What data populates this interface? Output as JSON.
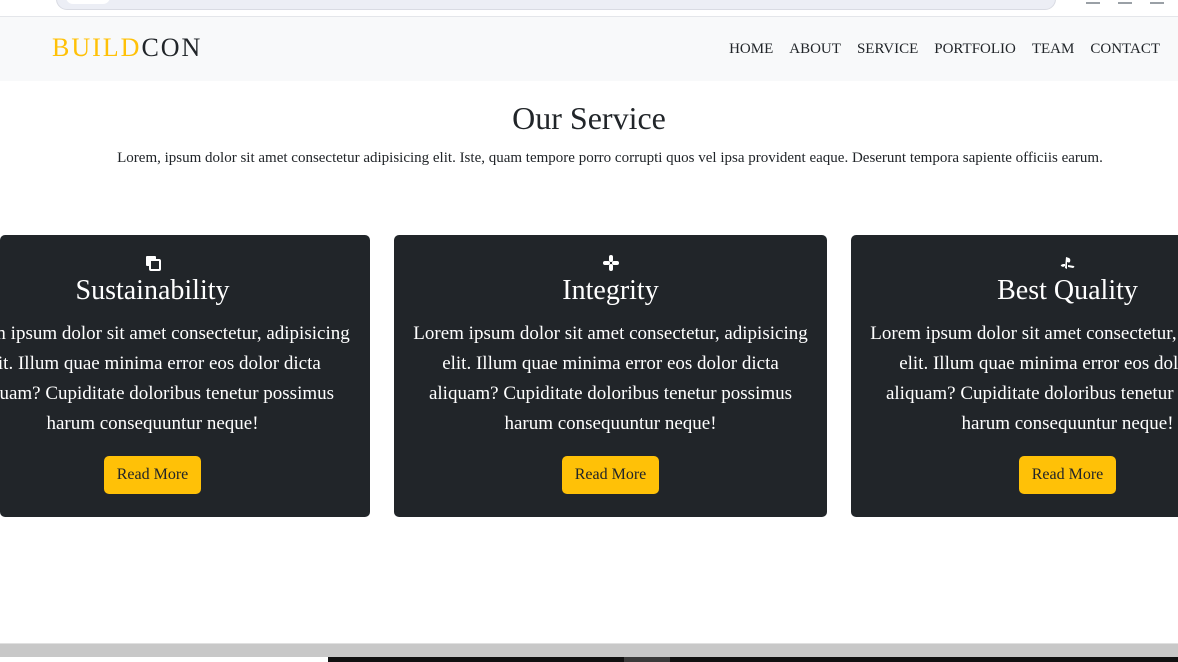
{
  "navbar": {
    "brand_accent": "BUILD",
    "brand_rest": "CON",
    "links": [
      "HOME",
      "ABOUT",
      "SERVICE",
      "PORTFOLIO",
      "TEAM",
      "CONTACT"
    ]
  },
  "service": {
    "title": "Our Service",
    "description": "Lorem, ipsum dolor sit amet consectetur adipisicing elit. Iste, quam tempore porro corrupti quos vel ipsa provident eaque. Deserunt tempora sapiente officiis earum."
  },
  "cards": [
    {
      "icon": "copy-icon",
      "title": "Sustainability",
      "text": "Lorem ipsum dolor sit amet consectetur, adipisicing elit. Illum quae minima error eos dolor dicta aliquam? Cupiditate doloribus tenetur possimus harum consequuntur neque!",
      "button": "Read More"
    },
    {
      "icon": "slack-icon",
      "title": "Integrity",
      "text": "Lorem ipsum dolor sit amet consectetur, adipisicing elit. Illum quae minima error eos dolor dicta aliquam? Cupiditate doloribus tenetur possimus harum consequuntur neque!",
      "button": "Read More"
    },
    {
      "icon": "playstation-icon",
      "title": "Best Quality",
      "text": "Lorem ipsum dolor sit amet consectetur, adipisicing elit. Illum quae minima error eos dolor dicta aliquam? Cupiditate doloribus tenetur possimus harum consequuntur neque!",
      "button": "Read More"
    }
  ],
  "colors": {
    "accent": "#ffc107",
    "dark": "#212529",
    "navbar_bg": "#f8f9fa"
  }
}
